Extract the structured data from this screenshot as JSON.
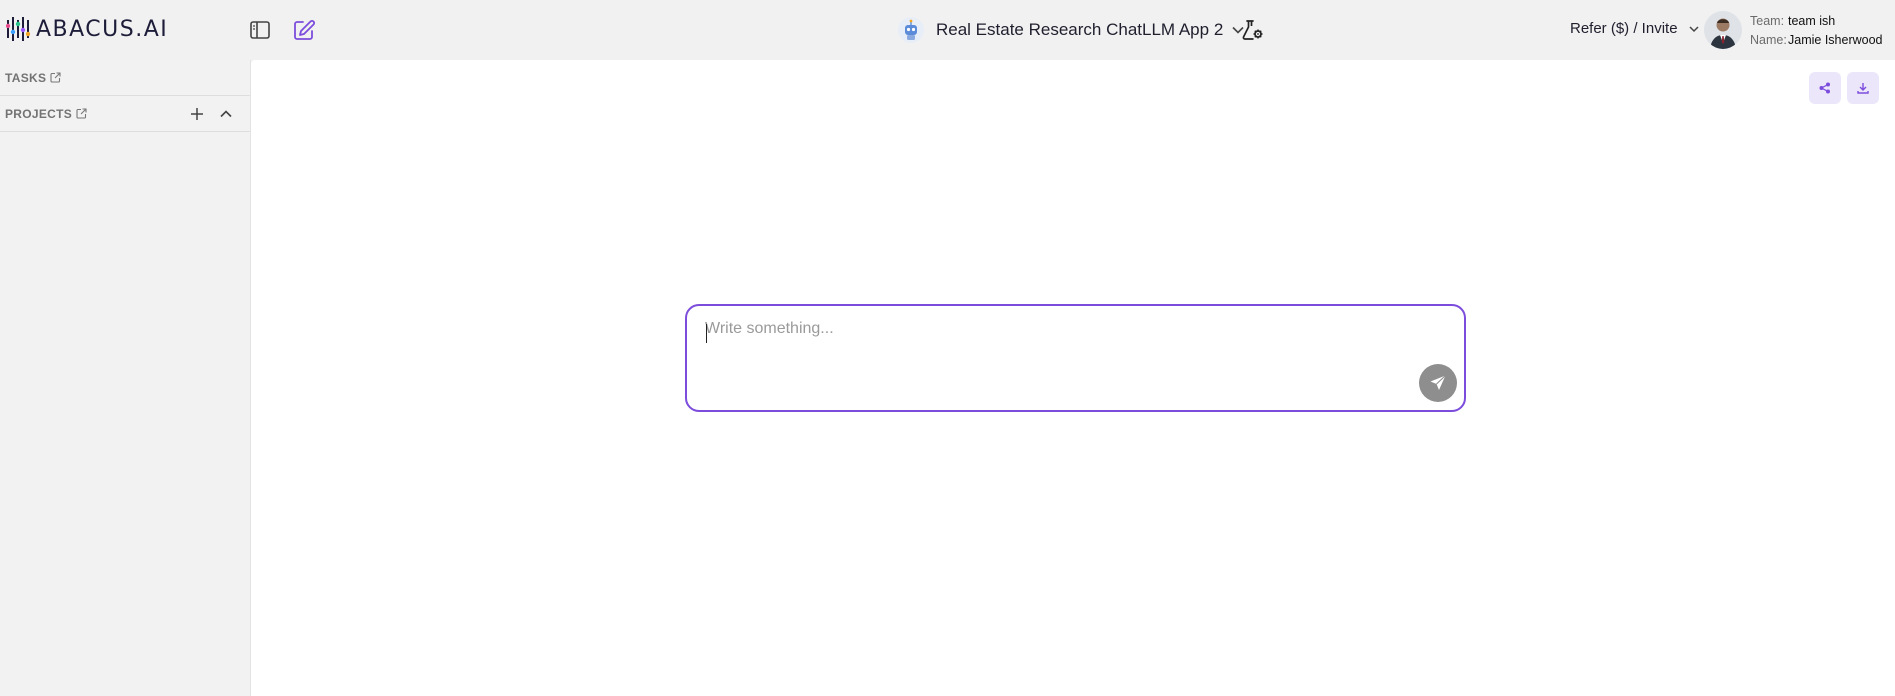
{
  "header": {
    "logo_text": "ABACUS.AI",
    "app_name": "Real Estate Research ChatLLM App 2",
    "refer_label": "Refer ($) / Invite",
    "team_key": "Team:",
    "team_value": "team ish",
    "name_key": "Name:",
    "name_value": "Jamie Isherwood",
    "icons": {
      "sidebar_toggle": "sidebar-toggle-icon",
      "new_chat": "edit-icon",
      "app_avatar": "robot-icon",
      "app_chevron": "chevron-down-icon",
      "lab": "flask-settings-icon",
      "refer_chevron": "chevron-down-icon"
    }
  },
  "sidebar": {
    "tasks_label": "TASKS",
    "projects_label": "PROJECTS"
  },
  "main": {
    "composer": {
      "value": "",
      "placeholder": "Write something..."
    }
  },
  "colors": {
    "accent": "#7c4ddc",
    "accent_light": "#ece6fb",
    "send_button": "#8e8e8e",
    "header_bg": "#f1f1f1",
    "main_bg": "#ffffff"
  }
}
